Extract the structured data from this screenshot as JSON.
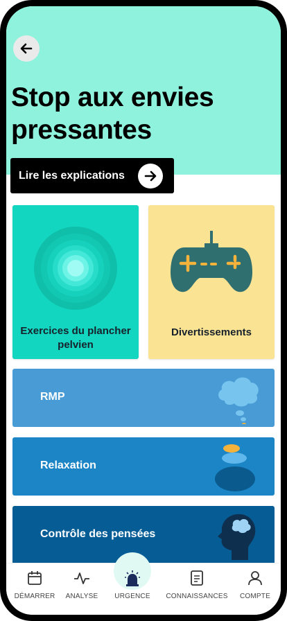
{
  "header": {
    "title": "Stop aux envies pressantes",
    "explain_label": "Lire les explications"
  },
  "tiles": {
    "pelvic": "Exercices du plancher pelvien",
    "fun": "Divertissements"
  },
  "rows": [
    {
      "label": "RMP"
    },
    {
      "label": "Relaxation"
    },
    {
      "label": "Contrôle des pensées"
    }
  ],
  "nav": [
    {
      "label": "DÉMARRER",
      "icon": "calendar-icon"
    },
    {
      "label": "ANALYSE",
      "icon": "pulse-icon"
    },
    {
      "label": "URGENCE",
      "icon": "alarm-icon"
    },
    {
      "label": "CONNAISSANCES",
      "icon": "document-icon"
    },
    {
      "label": "COMPTE",
      "icon": "user-icon"
    }
  ],
  "colors": {
    "hero_bg": "#8ef2dc",
    "pelvic_tile": "#13d6c0",
    "fun_tile": "#fbe394",
    "rmp_row": "#489bd4",
    "relax_row": "#1b85c6",
    "thoughts_row": "#065d96"
  }
}
